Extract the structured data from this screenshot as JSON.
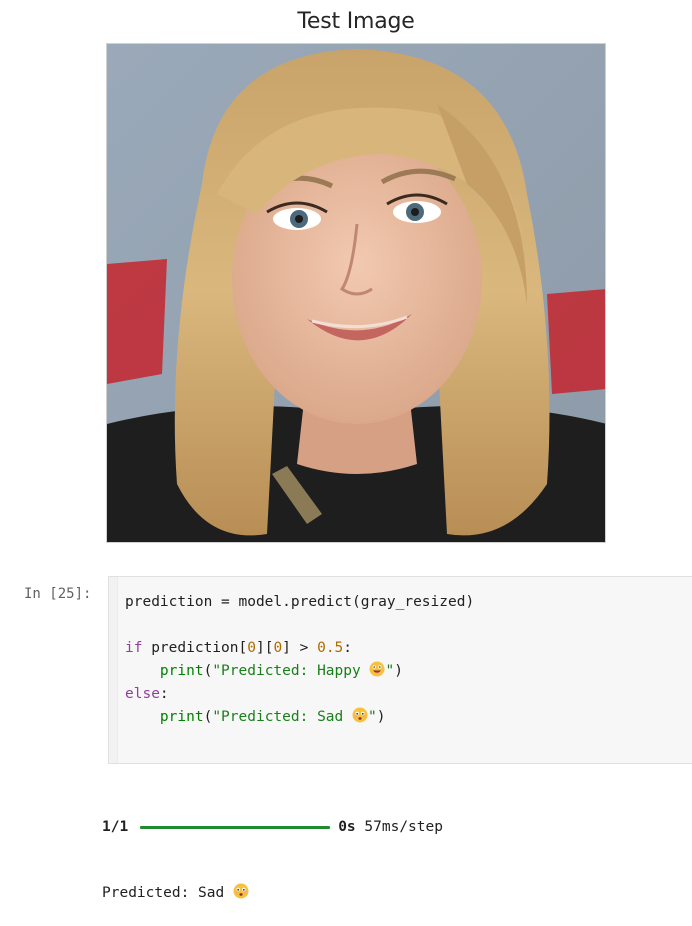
{
  "figure": {
    "title": "Test Image",
    "image_description_icon": "portrait-photo"
  },
  "cell": {
    "prompt": "In [25]:",
    "code_lines": {
      "l1": "prediction = model.predict(gray_resized)",
      "l3_kw": "if",
      "l3_a": " prediction[",
      "l3_n1": "0",
      "l3_b": "][",
      "l3_n2": "0",
      "l3_c": "] > ",
      "l3_n3": "0.5",
      "l3_d": ":",
      "l4_indent": "    ",
      "l4_fn": "print",
      "l4_open": "(",
      "l4_str": "\"Predicted: Happy ",
      "l4_str_end": "\"",
      "l4_close": ")",
      "l5_kw": "else",
      "l5_d": ":",
      "l6_indent": "    ",
      "l6_fn": "print",
      "l6_open": "(",
      "l6_str": "\"Predicted: Sad ",
      "l6_str_end": "\"",
      "l6_close": ")"
    }
  },
  "output": {
    "step": "1/1",
    "progress": 1.0,
    "time_bold": "0s",
    "time_rest": "57ms/step",
    "result": "Predicted: Sad "
  },
  "colors": {
    "keyword": "#8f3f9c",
    "builtin": "#008000",
    "number": "#ad6b00",
    "progress": "#1f8a2e"
  }
}
